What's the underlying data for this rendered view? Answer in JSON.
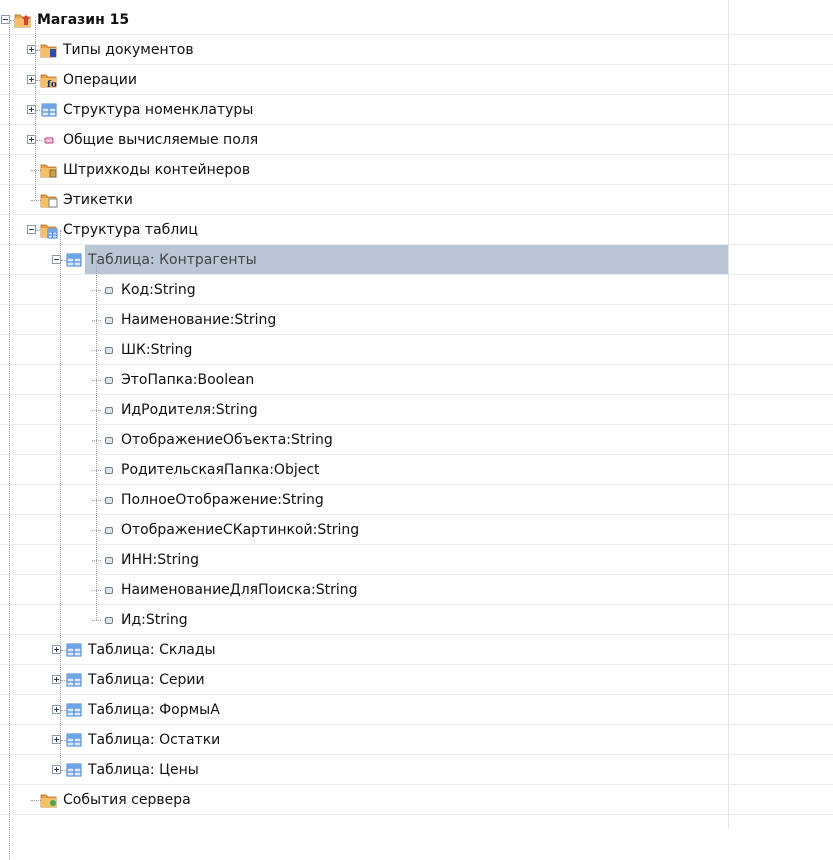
{
  "tree": {
    "root": {
      "label": "Магазин 15",
      "icon": "folder-arrow-icon"
    },
    "items": [
      {
        "label": "Типы документов",
        "icon": "folder-doc-icon",
        "toggle": "plus"
      },
      {
        "label": "Операции",
        "icon": "folder-fo-icon",
        "toggle": "plus"
      },
      {
        "label": "Структура номенклатуры",
        "icon": "table-icon",
        "toggle": "plus"
      },
      {
        "label": "Общие вычисляемые поля",
        "icon": "field-icon",
        "toggle": "plus"
      },
      {
        "label": "Штрихкоды контейнеров",
        "icon": "folder-box-icon",
        "toggle": "none"
      },
      {
        "label": "Этикетки",
        "icon": "folder-label-icon",
        "toggle": "none"
      },
      {
        "label": "Структура таблиц",
        "icon": "folder-table-icon",
        "toggle": "minus"
      }
    ],
    "selected_table": {
      "label": "Таблица: Контрагенты",
      "icon": "table-icon"
    },
    "fields": [
      "Код:String",
      "Наименование:String",
      "ШК:String",
      "ЭтоПапка:Boolean",
      "ИдРодителя:String",
      "ОтображениеОбъекта:String",
      "РодительскаяПапка:Object",
      "ПолноеОтображение:String",
      "ОтображениеСКартинкой:String",
      "ИНН:String",
      "НаименованиеДляПоиска:String",
      "Ид:String"
    ],
    "other_tables": [
      "Таблица: Склады",
      "Таблица: Серии",
      "Таблица: ФормыА",
      "Таблица: Остатки",
      "Таблица: Цены"
    ],
    "last_item": {
      "label": "События сервера",
      "icon": "folder-event-icon"
    }
  }
}
